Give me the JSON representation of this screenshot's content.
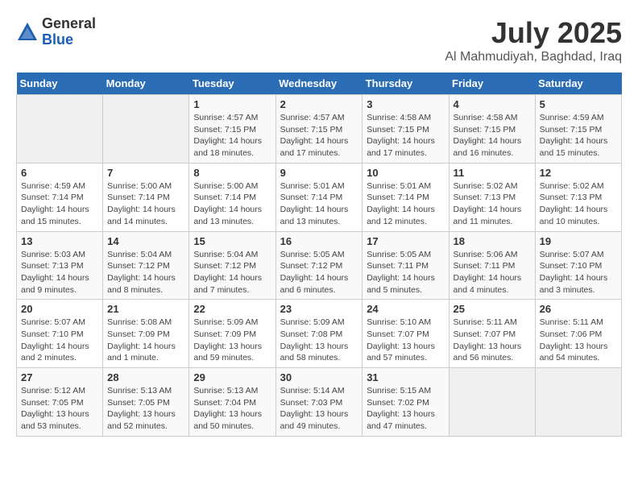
{
  "logo": {
    "general": "General",
    "blue": "Blue"
  },
  "title": "July 2025",
  "subtitle": "Al Mahmudiyah, Baghdad, Iraq",
  "headers": [
    "Sunday",
    "Monday",
    "Tuesday",
    "Wednesday",
    "Thursday",
    "Friday",
    "Saturday"
  ],
  "weeks": [
    [
      {
        "day": "",
        "info": ""
      },
      {
        "day": "",
        "info": ""
      },
      {
        "day": "1",
        "info": "Sunrise: 4:57 AM\nSunset: 7:15 PM\nDaylight: 14 hours\nand 18 minutes."
      },
      {
        "day": "2",
        "info": "Sunrise: 4:57 AM\nSunset: 7:15 PM\nDaylight: 14 hours\nand 17 minutes."
      },
      {
        "day": "3",
        "info": "Sunrise: 4:58 AM\nSunset: 7:15 PM\nDaylight: 14 hours\nand 17 minutes."
      },
      {
        "day": "4",
        "info": "Sunrise: 4:58 AM\nSunset: 7:15 PM\nDaylight: 14 hours\nand 16 minutes."
      },
      {
        "day": "5",
        "info": "Sunrise: 4:59 AM\nSunset: 7:15 PM\nDaylight: 14 hours\nand 15 minutes."
      }
    ],
    [
      {
        "day": "6",
        "info": "Sunrise: 4:59 AM\nSunset: 7:14 PM\nDaylight: 14 hours\nand 15 minutes."
      },
      {
        "day": "7",
        "info": "Sunrise: 5:00 AM\nSunset: 7:14 PM\nDaylight: 14 hours\nand 14 minutes."
      },
      {
        "day": "8",
        "info": "Sunrise: 5:00 AM\nSunset: 7:14 PM\nDaylight: 14 hours\nand 13 minutes."
      },
      {
        "day": "9",
        "info": "Sunrise: 5:01 AM\nSunset: 7:14 PM\nDaylight: 14 hours\nand 13 minutes."
      },
      {
        "day": "10",
        "info": "Sunrise: 5:01 AM\nSunset: 7:14 PM\nDaylight: 14 hours\nand 12 minutes."
      },
      {
        "day": "11",
        "info": "Sunrise: 5:02 AM\nSunset: 7:13 PM\nDaylight: 14 hours\nand 11 minutes."
      },
      {
        "day": "12",
        "info": "Sunrise: 5:02 AM\nSunset: 7:13 PM\nDaylight: 14 hours\nand 10 minutes."
      }
    ],
    [
      {
        "day": "13",
        "info": "Sunrise: 5:03 AM\nSunset: 7:13 PM\nDaylight: 14 hours\nand 9 minutes."
      },
      {
        "day": "14",
        "info": "Sunrise: 5:04 AM\nSunset: 7:12 PM\nDaylight: 14 hours\nand 8 minutes."
      },
      {
        "day": "15",
        "info": "Sunrise: 5:04 AM\nSunset: 7:12 PM\nDaylight: 14 hours\nand 7 minutes."
      },
      {
        "day": "16",
        "info": "Sunrise: 5:05 AM\nSunset: 7:12 PM\nDaylight: 14 hours\nand 6 minutes."
      },
      {
        "day": "17",
        "info": "Sunrise: 5:05 AM\nSunset: 7:11 PM\nDaylight: 14 hours\nand 5 minutes."
      },
      {
        "day": "18",
        "info": "Sunrise: 5:06 AM\nSunset: 7:11 PM\nDaylight: 14 hours\nand 4 minutes."
      },
      {
        "day": "19",
        "info": "Sunrise: 5:07 AM\nSunset: 7:10 PM\nDaylight: 14 hours\nand 3 minutes."
      }
    ],
    [
      {
        "day": "20",
        "info": "Sunrise: 5:07 AM\nSunset: 7:10 PM\nDaylight: 14 hours\nand 2 minutes."
      },
      {
        "day": "21",
        "info": "Sunrise: 5:08 AM\nSunset: 7:09 PM\nDaylight: 14 hours\nand 1 minute."
      },
      {
        "day": "22",
        "info": "Sunrise: 5:09 AM\nSunset: 7:09 PM\nDaylight: 13 hours\nand 59 minutes."
      },
      {
        "day": "23",
        "info": "Sunrise: 5:09 AM\nSunset: 7:08 PM\nDaylight: 13 hours\nand 58 minutes."
      },
      {
        "day": "24",
        "info": "Sunrise: 5:10 AM\nSunset: 7:07 PM\nDaylight: 13 hours\nand 57 minutes."
      },
      {
        "day": "25",
        "info": "Sunrise: 5:11 AM\nSunset: 7:07 PM\nDaylight: 13 hours\nand 56 minutes."
      },
      {
        "day": "26",
        "info": "Sunrise: 5:11 AM\nSunset: 7:06 PM\nDaylight: 13 hours\nand 54 minutes."
      }
    ],
    [
      {
        "day": "27",
        "info": "Sunrise: 5:12 AM\nSunset: 7:05 PM\nDaylight: 13 hours\nand 53 minutes."
      },
      {
        "day": "28",
        "info": "Sunrise: 5:13 AM\nSunset: 7:05 PM\nDaylight: 13 hours\nand 52 minutes."
      },
      {
        "day": "29",
        "info": "Sunrise: 5:13 AM\nSunset: 7:04 PM\nDaylight: 13 hours\nand 50 minutes."
      },
      {
        "day": "30",
        "info": "Sunrise: 5:14 AM\nSunset: 7:03 PM\nDaylight: 13 hours\nand 49 minutes."
      },
      {
        "day": "31",
        "info": "Sunrise: 5:15 AM\nSunset: 7:02 PM\nDaylight: 13 hours\nand 47 minutes."
      },
      {
        "day": "",
        "info": ""
      },
      {
        "day": "",
        "info": ""
      }
    ]
  ]
}
